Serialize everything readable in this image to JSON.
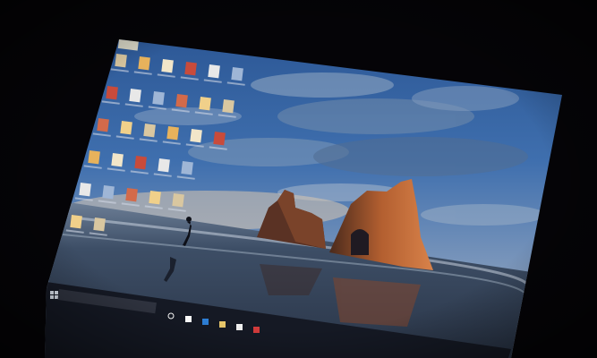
{
  "scene": {
    "description_free": true,
    "colors": {
      "room": "#050407",
      "sky_top": "#2e5fa6",
      "sky_mid": "#4d79b3",
      "sky_low": "#8fa7c4",
      "horizon_glow": "#c9b9a3",
      "sea": "#2f4157",
      "wet_sand": "#39475e",
      "rock_lit": "#c46a35",
      "rock_shadow": "#3a2018",
      "taskbar": "#141722"
    }
  },
  "screen": {
    "wallpaper": "beach-rocks-sunset",
    "taskbar": {
      "search_placeholder": "",
      "icons": [
        "start-icon",
        "cortana-circle-icon",
        "task-view-icon",
        "edge-icon",
        "file-explorer-icon",
        "store-icon",
        "red-app-icon"
      ]
    },
    "desktop_icon_count": 30
  }
}
